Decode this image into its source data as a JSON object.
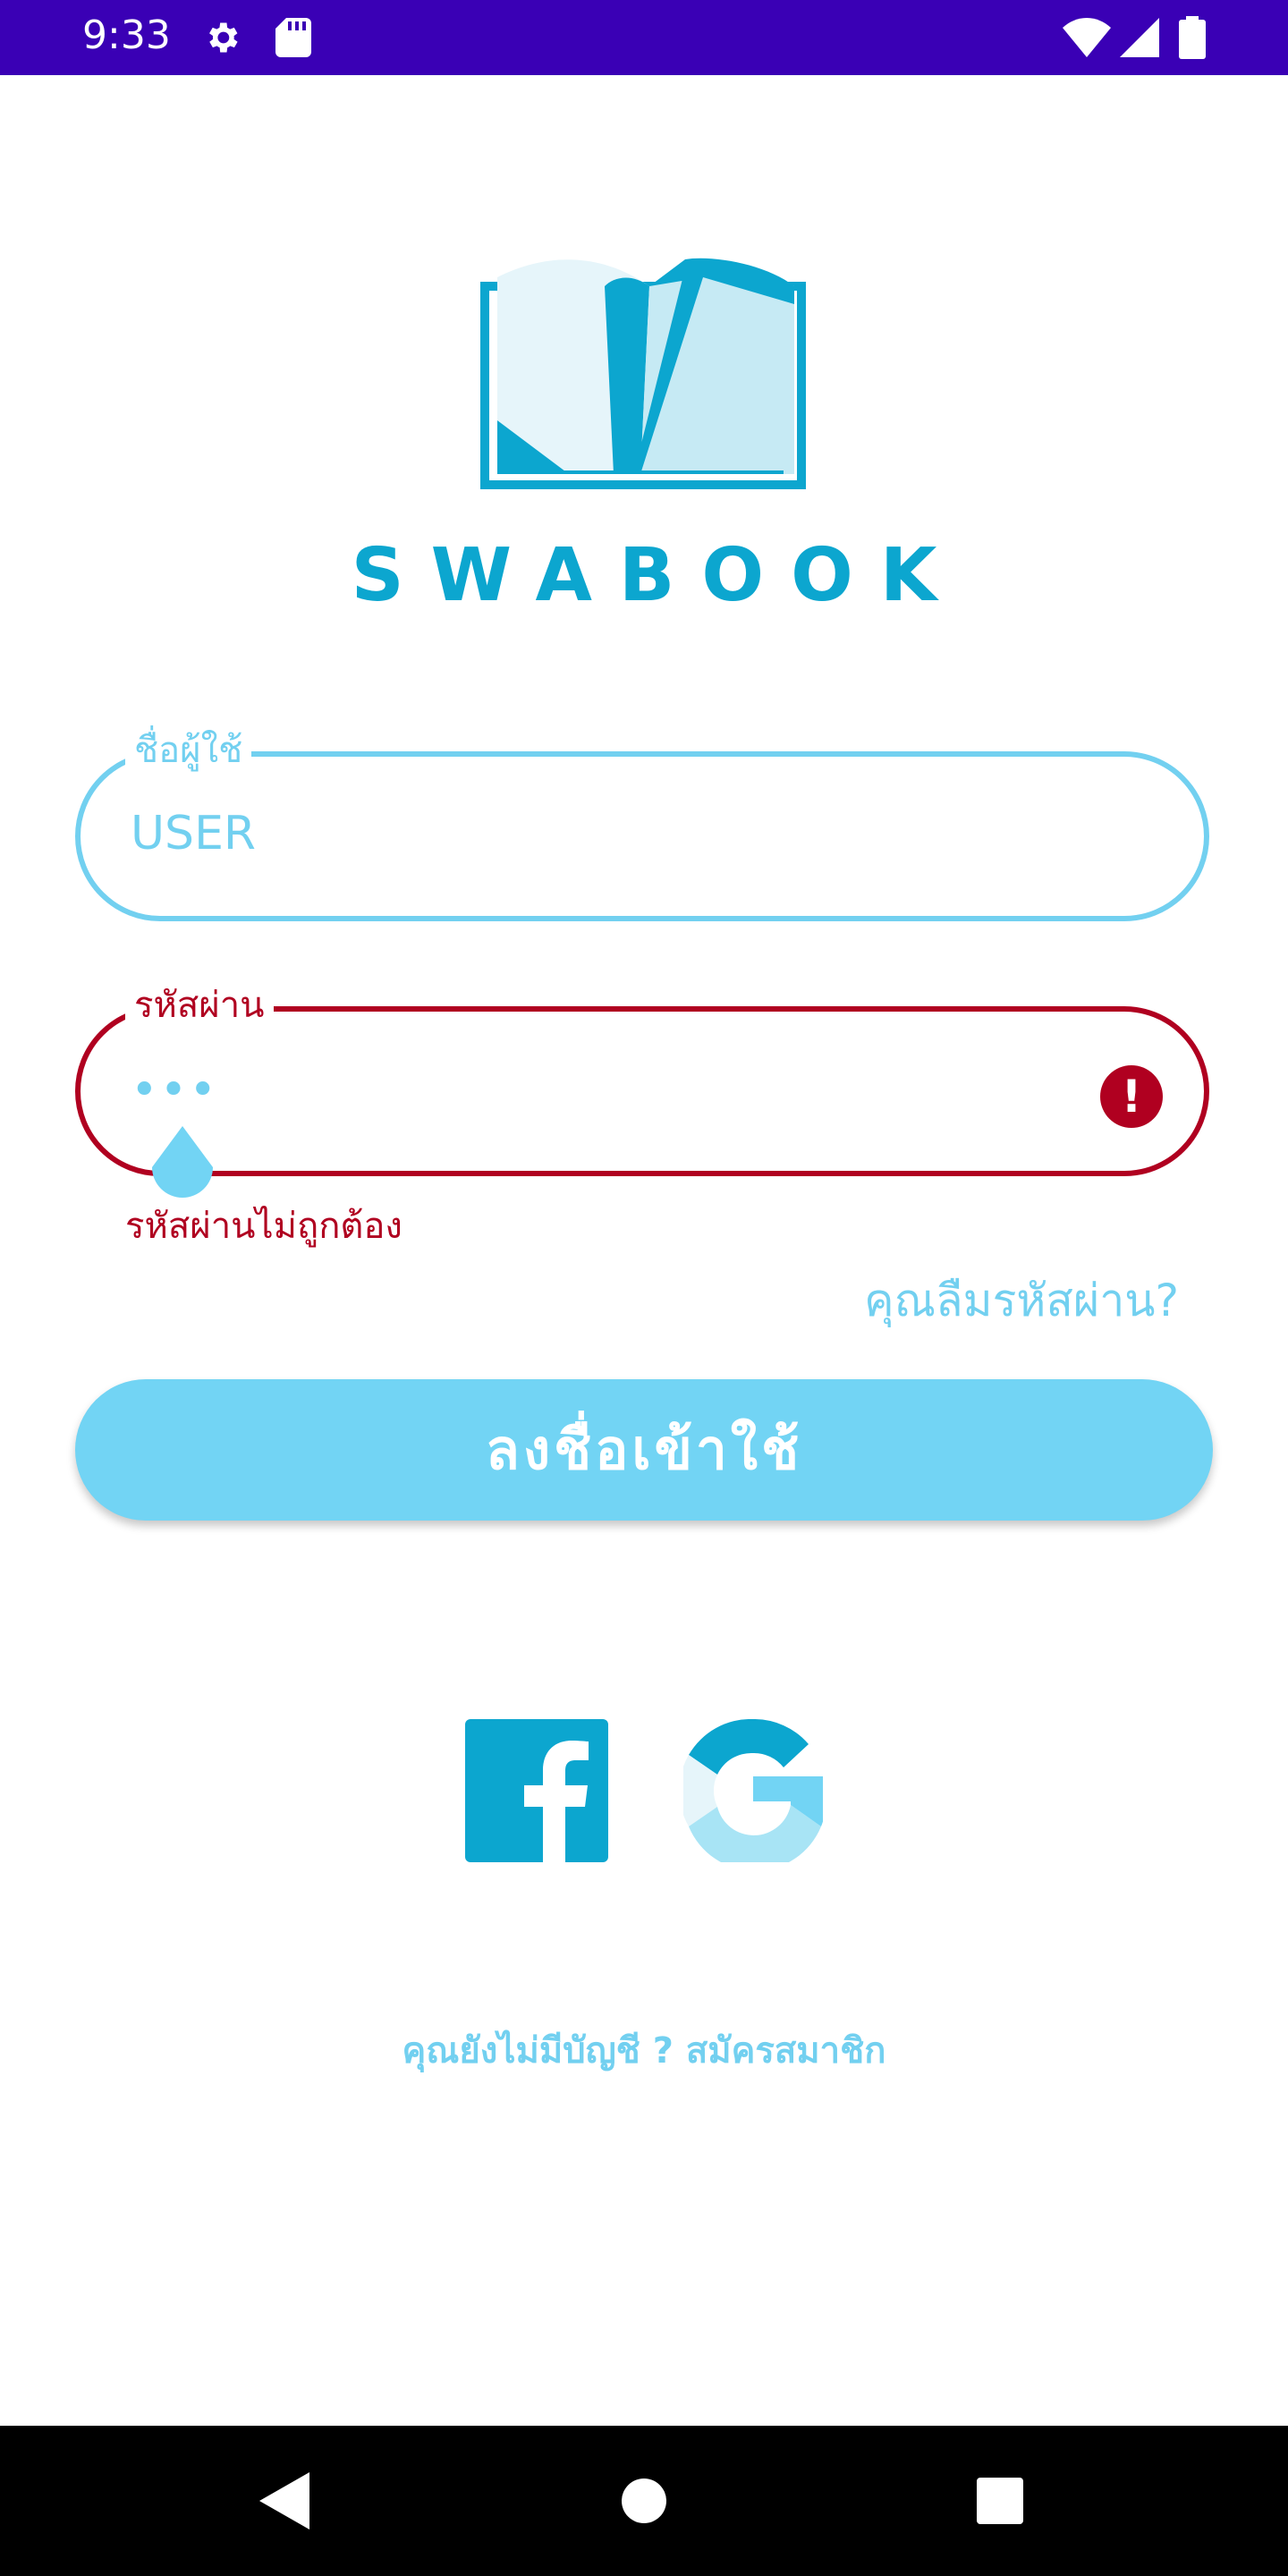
{
  "status_bar": {
    "time": "9:33",
    "icons": [
      "gear-icon",
      "sd-card-icon",
      "wifi-icon",
      "signal-icon",
      "battery-icon"
    ],
    "background": "#3a00b5"
  },
  "app": {
    "brand": "SWABOOK",
    "brand_color": "#0ca6cf"
  },
  "login_form": {
    "username": {
      "label": "ชื่อผู้ใช้",
      "value": "USER"
    },
    "password": {
      "label": "รหัสผ่าน",
      "value": "•••",
      "error": "รหัสผ่านไม่ถูกต้อง"
    },
    "forgot_password": "คุณลืมรหัสผ่าน?",
    "login_button": "ลงชื่อเข้าใช้"
  },
  "social": {
    "icons": [
      "facebook-icon",
      "google-icon"
    ]
  },
  "signup_prompt": "คุณยังไม่มีบัญชี ? สมัครสมาชิก",
  "colors": {
    "accent": "#72d4f4",
    "error": "#b00020"
  }
}
